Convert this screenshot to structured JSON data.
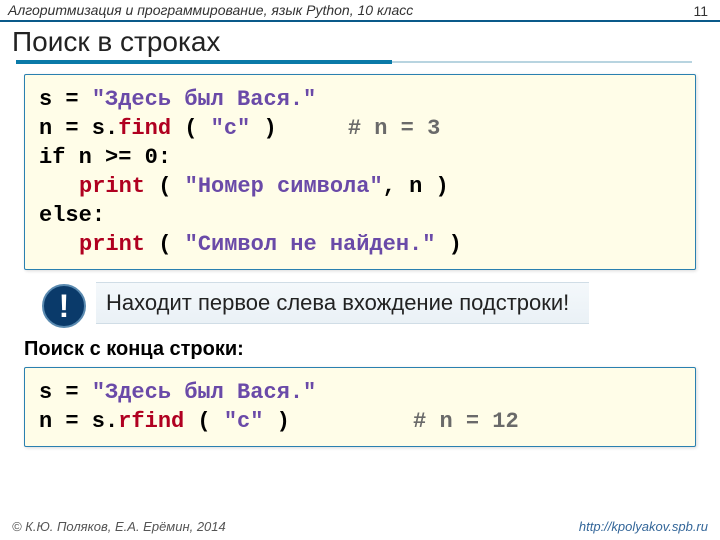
{
  "header": {
    "course": "Алгоритмизация и программирование, язык Python, 10 класс",
    "page": "11"
  },
  "title": "Поиск в строках",
  "code1": {
    "l1a": "s = ",
    "l1b": "\"Здесь был Вася.\"",
    "l2a": "n = s.",
    "l2b": "find",
    "l2c": " ( ",
    "l2d": "\"с\"",
    "l2e": " )",
    "l2f": "   # n = 3",
    "l3a": "if",
    "l3b": " n >= 0:",
    "l4a": "print",
    "l4b": " ( ",
    "l4c": "\"Номер символа\"",
    "l4d": ", n )",
    "l5a": "else",
    "l5b": ":",
    "l6a": "print",
    "l6b": " ( ",
    "l6c": "\"Символ не найден.\"",
    "l6d": " )"
  },
  "note": {
    "mark": "!",
    "text": "Находит первое слева вхождение подстроки!"
  },
  "subheading": "Поиск с конца строки:",
  "code2": {
    "l1a": "s = ",
    "l1b": "\"Здесь был Вася.\"",
    "l2a": "n = s.",
    "l2b": "rfind",
    "l2c": " ( ",
    "l2d": "\"с\"",
    "l2e": " )",
    "l2f": "   # n = 12"
  },
  "footer": {
    "left": "© К.Ю. Поляков, Е.А. Ерёмин, 2014",
    "right": "http://kpolyakov.spb.ru"
  }
}
